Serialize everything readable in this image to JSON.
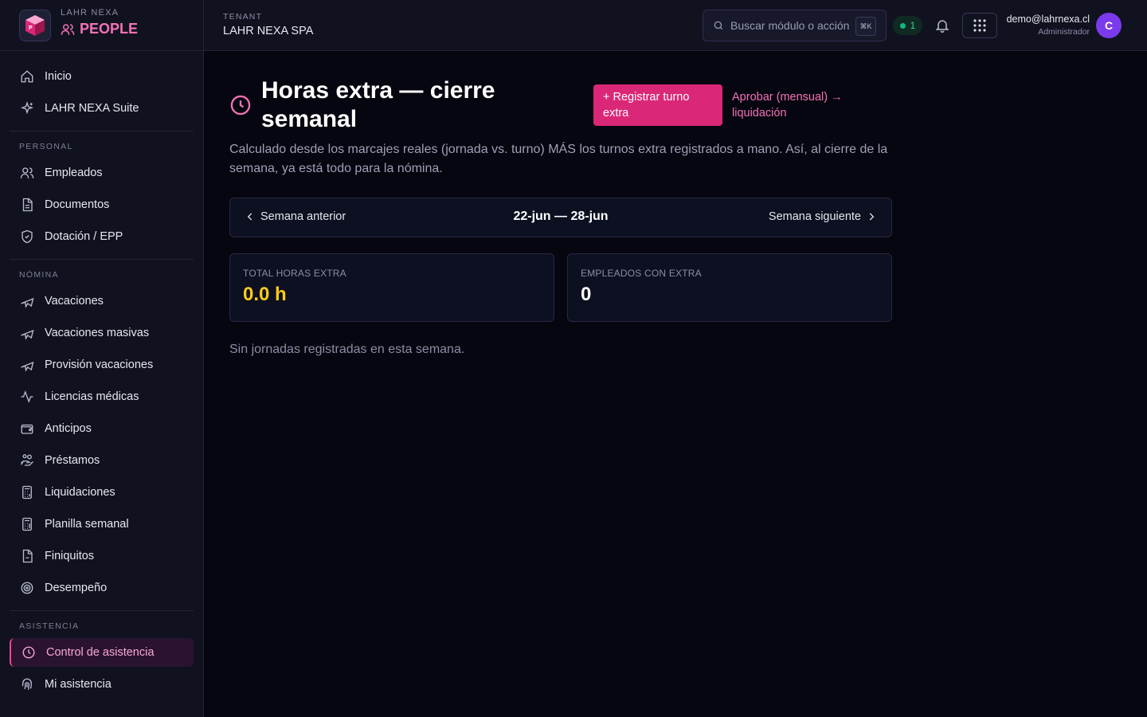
{
  "brand": {
    "top": "LAHR NEXA",
    "name": "PEOPLE",
    "logo_letter": "P"
  },
  "sidebar": {
    "top_items": [
      {
        "label": "Inicio",
        "icon": "home-icon"
      },
      {
        "label": "LAHR NEXA Suite",
        "icon": "sparkles-icon"
      }
    ],
    "sections": [
      {
        "title": "PERSONAL",
        "items": [
          {
            "label": "Empleados",
            "icon": "users-icon"
          },
          {
            "label": "Documentos",
            "icon": "document-icon"
          },
          {
            "label": "Dotación / EPP",
            "icon": "shield-check-icon"
          }
        ]
      },
      {
        "title": "NÓMINA",
        "items": [
          {
            "label": "Vacaciones",
            "icon": "plane-icon"
          },
          {
            "label": "Vacaciones masivas",
            "icon": "plane-icon"
          },
          {
            "label": "Provisión vacaciones",
            "icon": "plane-icon"
          },
          {
            "label": "Licencias médicas",
            "icon": "activity-icon"
          },
          {
            "label": "Anticipos",
            "icon": "wallet-icon"
          },
          {
            "label": "Préstamos",
            "icon": "hand-coins-icon"
          },
          {
            "label": "Liquidaciones",
            "icon": "calculator-icon"
          },
          {
            "label": "Planilla semanal",
            "icon": "calculator-icon"
          },
          {
            "label": "Finiquitos",
            "icon": "file-icon"
          },
          {
            "label": "Desempeño",
            "icon": "target-icon"
          }
        ]
      },
      {
        "title": "ASISTENCIA",
        "items": [
          {
            "label": "Control de asistencia",
            "icon": "clock-icon",
            "active": true
          },
          {
            "label": "Mi asistencia",
            "icon": "fingerprint-icon"
          }
        ]
      }
    ]
  },
  "topbar": {
    "tenant_label": "TENANT",
    "tenant_name": "LAHR NEXA SPA",
    "search_placeholder": "Buscar módulo o acción",
    "search_shortcut": "⌘K",
    "status_count": "1",
    "user_email": "demo@lahrnexa.cl",
    "user_role": "Administrador",
    "avatar_letter": "C"
  },
  "page": {
    "title": "Horas extra — cierre semanal",
    "primary_button": "+ Registrar turno extra",
    "approve_link": "Aprobar (mensual) → liquidación",
    "description": "Calculado desde los marcajes reales (jornada vs. turno) MÁS los turnos extra registrados a mano. Así, al cierre de la semana, ya está todo para la nómina.",
    "week": {
      "prev": "Semana anterior",
      "range": "22-jun — 28-jun",
      "next": "Semana siguiente"
    },
    "stats": [
      {
        "label": "TOTAL HORAS EXTRA",
        "value": "0.0 h",
        "color": "#facc15"
      },
      {
        "label": "EMPLEADOS CON EXTRA",
        "value": "0",
        "color": "#ffffff"
      }
    ],
    "empty_message": "Sin jornadas registradas en esta semana."
  },
  "colors": {
    "accent": "#ec4899",
    "background": "#05060f",
    "sidebar": "#11121f"
  }
}
